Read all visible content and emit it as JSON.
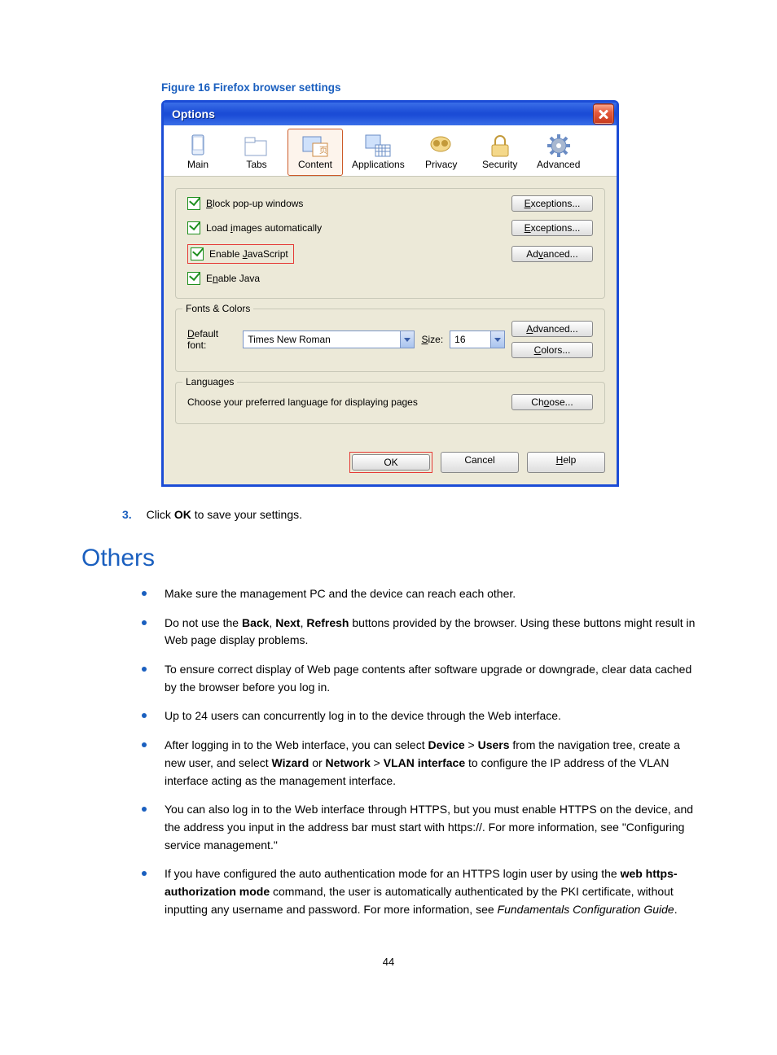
{
  "figure_caption": "Figure 16 Firefox browser settings",
  "titlebar": {
    "title": "Options"
  },
  "tabs": {
    "main": "Main",
    "tabs": "Tabs",
    "content": "Content",
    "applications": "Applications",
    "privacy": "Privacy",
    "security": "Security",
    "advanced": "Advanced"
  },
  "checks": {
    "popup": "Block pop-up windows",
    "images": "Load images automatically",
    "js": "Enable JavaScript",
    "java": "Enable Java"
  },
  "btns": {
    "exceptions": "Exceptions...",
    "advanced": "Advanced...",
    "colors": "Colors...",
    "choose": "Choose...",
    "ok": "OK",
    "cancel": "Cancel",
    "help": "Help"
  },
  "fonts_colors": {
    "legend": "Fonts & Colors",
    "default_font_label": "Default font:",
    "font_value": "Times New Roman",
    "size_label": "Size:",
    "size_value": "16"
  },
  "languages": {
    "legend": "Languages",
    "prompt": "Choose your preferred language for displaying pages"
  },
  "step": {
    "num": "3.",
    "pre": "Click ",
    "bold": "OK",
    "post": " to save your settings."
  },
  "heading_others": "Others",
  "bullets": {
    "b1": "Make sure the management PC and the device can reach each other.",
    "b2a": "Do not use the ",
    "b2_back": "Back",
    "b2_comma1": ", ",
    "b2_next": "Next",
    "b2_comma2": ", ",
    "b2_refresh": "Refresh",
    "b2b": " buttons provided by the browser. Using these buttons might result in Web page display problems.",
    "b3": "To ensure correct display of Web page contents after software upgrade or downgrade, clear data cached by the browser before you log in.",
    "b4": "Up to 24 users can concurrently log in to the device through the Web interface.",
    "b5a": "After logging in to the Web interface, you can select ",
    "b5_device": "Device",
    "b5_gt1": " > ",
    "b5_users": "Users",
    "b5b": " from the navigation tree, create a new user, and select ",
    "b5_wizard": "Wizard",
    "b5_or": " or ",
    "b5_network": "Network",
    "b5_gt2": " > ",
    "b5_vlan": "VLAN interface",
    "b5c": " to configure the IP address of the VLAN interface acting as the management interface.",
    "b6": "You can also log in to the Web interface through HTTPS, but you must enable HTTPS on the device, and the address you input in the address bar must start with https://. For more information, see \"Configuring service management.\"",
    "b7a": "If you have configured the auto authentication mode for an HTTPS login user by using the ",
    "b7_web": "web https-authorization mode",
    "b7b": " command, the user is automatically authenticated by the PKI certificate, without inputting any username and password. For more information, see ",
    "b7_ital": "Fundamentals Configuration Guide",
    "b7c": "."
  },
  "page_number": "44"
}
